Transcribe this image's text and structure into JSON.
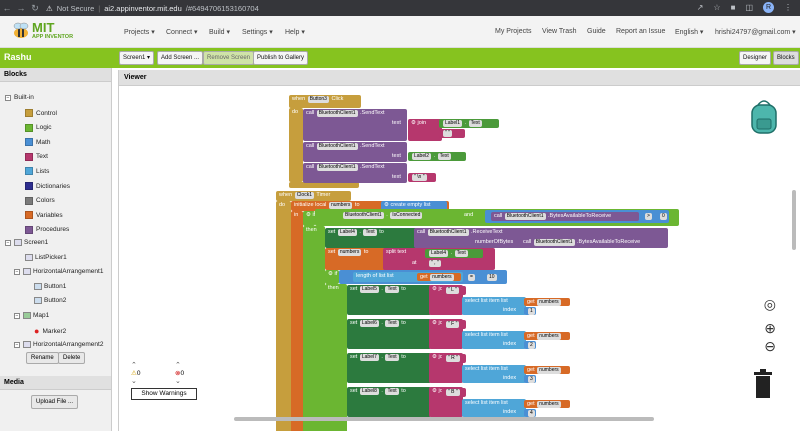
{
  "browser": {
    "security_label": "Not Secure",
    "url_host": "ai2.appinventor.mit.edu",
    "url_hash": "/#6494706153160704",
    "profile_initial": "R"
  },
  "brand": {
    "name": "MIT",
    "subtitle": "APP INVENTOR"
  },
  "menu": {
    "projects": "Projects",
    "connect": "Connect",
    "build": "Build",
    "settings": "Settings",
    "help": "Help",
    "my_projects": "My Projects",
    "view_trash": "View Trash",
    "guide": "Guide",
    "report_issue": "Report an Issue",
    "language": "English",
    "account": "hrishi24797@gmail.com"
  },
  "toolbar": {
    "project_name": "Rashu",
    "screen": "Screen1",
    "add_screen": "Add Screen ...",
    "remove_screen": "Remove Screen",
    "publish": "Publish to Gallery",
    "designer": "Designer",
    "blocks": "Blocks"
  },
  "blocks_panel": {
    "title": "Blocks",
    "built_in": "Built-in",
    "categories": [
      {
        "label": "Control",
        "color": "#c69e3d"
      },
      {
        "label": "Logic",
        "color": "#6bb632"
      },
      {
        "label": "Math",
        "color": "#4a8fd4"
      },
      {
        "label": "Text",
        "color": "#b6376d"
      },
      {
        "label": "Lists",
        "color": "#4fa6d8"
      },
      {
        "label": "Dictionaries",
        "color": "#2d2d8f"
      },
      {
        "label": "Colors",
        "color": "#7a7a7a"
      },
      {
        "label": "Variables",
        "color": "#d76a26"
      },
      {
        "label": "Procedures",
        "color": "#7d5894"
      }
    ],
    "tree": {
      "screen1": "Screen1",
      "listpicker1": "ListPicker1",
      "ha1": "HorizontalArrangement1",
      "button1": "Button1",
      "button2": "Button2",
      "map1": "Map1",
      "marker2": "Marker2",
      "ha2": "HorizontalArrangement2"
    },
    "rename": "Rename",
    "delete": "Delete"
  },
  "media": {
    "title": "Media",
    "upload": "Upload File ..."
  },
  "viewer": {
    "title": "Viewer"
  },
  "warnings": {
    "warn_count": "0",
    "error_count": "0",
    "show": "Show Warnings"
  },
  "code": {
    "when": "when",
    "do": "do",
    "call": "call",
    "text": "text",
    "join": "join",
    "button3": "Button3",
    "click": "Click",
    "bt": "BluetoothClient1",
    "sendtext": ".SendText",
    "label1": "Label1",
    "label2": "Label2",
    "text_prop": "Text",
    "q1": "\" \"",
    "qn": "\" \\n \"",
    "clock1": "Clock1",
    "timer": "Timer",
    "init_local": "initialize local",
    "numbers": "numbers",
    "to": "to",
    "create_empty": "create empty list",
    "in": "in",
    "if": "if",
    "then": "then",
    "isconnected": "IsConnected",
    "and": "and",
    "bytesavail": ".BytesAvailableToReceive",
    "gt": ">",
    "zero": "0",
    "set": "set",
    "label4": "Label4",
    "receivetext": ".ReceiveText",
    "numberofbytes": "numberOfBytes",
    "split": "split",
    "at": "at",
    "comma": "\" , \"",
    "length_of_list": "length of list",
    "list": "list",
    "get": "get",
    "eq": "=",
    "ten": "10",
    "select_item": "select list item",
    "index": "index",
    "label5": "Label5",
    "label6": "Label6",
    "label7": "Label7",
    "label8": "Label8",
    "L": "\" L \"",
    "F": "\" F \"",
    "R": "\" R \"",
    "B": "\" B \"",
    "i1": "1",
    "i2": "2",
    "i3": "3",
    "i4": "4"
  }
}
